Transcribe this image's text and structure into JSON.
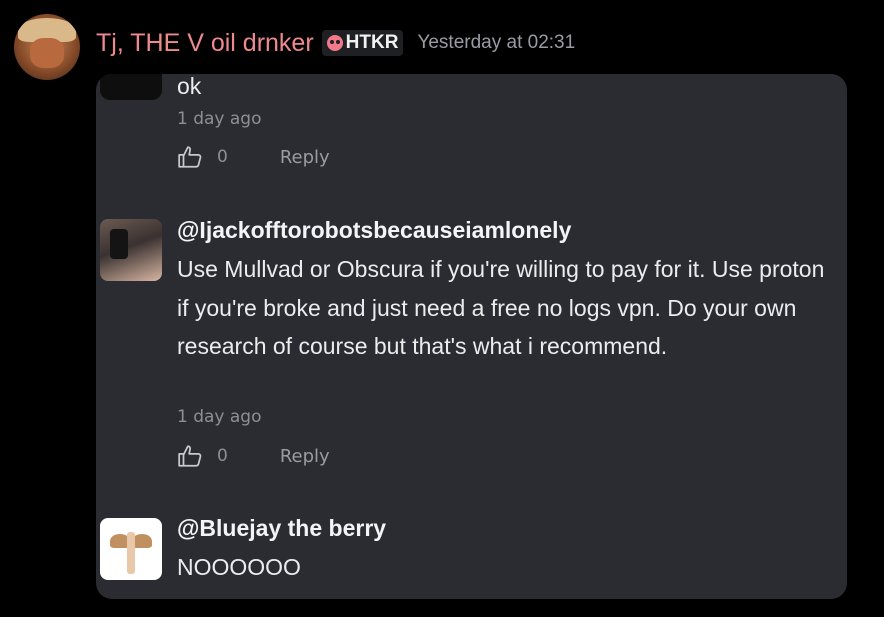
{
  "header": {
    "username": "Tj, THE V oil drnker",
    "tag": "HTKR",
    "timestamp": "Yesterday at 02:31"
  },
  "comments": [
    {
      "body": "ok",
      "time": "1 day ago",
      "likes": "0",
      "reply": "Reply"
    },
    {
      "author": "@Ijackofftorobotsbecauseiamlonely",
      "body": "Use Mullvad or Obscura if you're willing to pay for it. Use proton if you're broke and just need a free no logs vpn. Do your own research of course but that's what i recommend.",
      "time": "1 day ago",
      "likes": "0",
      "reply": "Reply"
    },
    {
      "author": "@Bluejay the berry",
      "body": "NOOOOOO"
    }
  ],
  "icons": {
    "like": "thumbs-up-icon",
    "tag": "skull-icon"
  },
  "colors": {
    "username": "#ee8a8e",
    "card": "#2b2c31",
    "background": "#000000"
  }
}
